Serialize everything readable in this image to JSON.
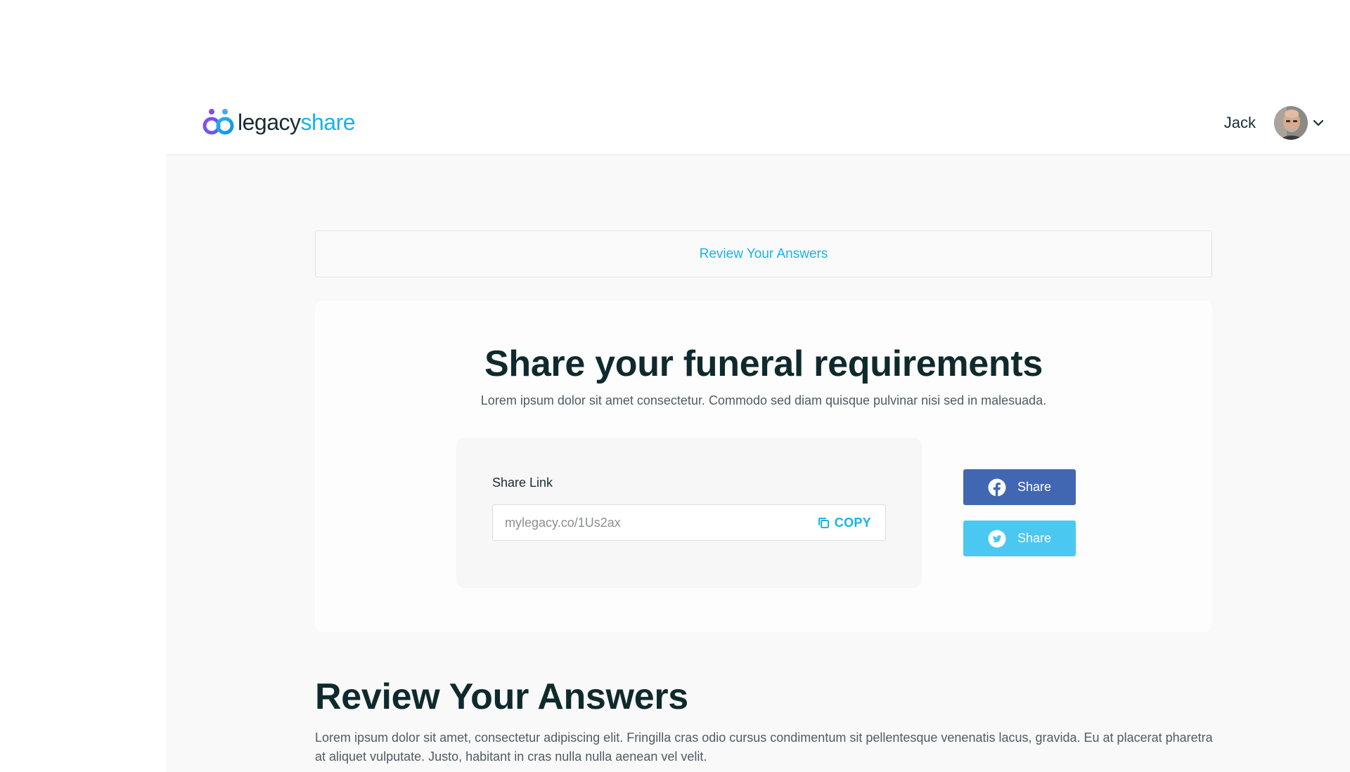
{
  "header": {
    "logo": {
      "text_primary": "legacy",
      "text_accent": "share",
      "icon": "legacyshare-logo-mark"
    },
    "user": {
      "name": "Jack",
      "avatar_icon": "user-avatar",
      "menu_icon": "chevron-down-icon"
    }
  },
  "review_banner": {
    "label": "Review Your Answers"
  },
  "share": {
    "title": "Share your funeral requirements",
    "subtitle": "Lorem ipsum dolor sit amet consectetur. Commodo sed diam quisque pulvinar nisi sed in malesuada.",
    "link_label": "Share Link",
    "link_value": "mylegacy.co/1Us2ax",
    "copy_label": "COPY",
    "facebook_label": "Share",
    "twitter_label": "Share"
  },
  "review": {
    "heading": "Review Your Answers",
    "description": "Lorem ipsum dolor sit amet, consectetur adipiscing elit. Fringilla cras odio cursus condimentum sit pellentesque venenatis lacus, gravida. Eu at placerat pharetra at aliquet vulputate. Justo, habitant in cras nulla nulla aenean vel velit."
  },
  "colors": {
    "accent": "#17b3e8",
    "facebook": "#4267b2",
    "twitter": "#4ac8f2",
    "logo_purple": "#7b4fe0",
    "heading": "#0f2a2c"
  }
}
